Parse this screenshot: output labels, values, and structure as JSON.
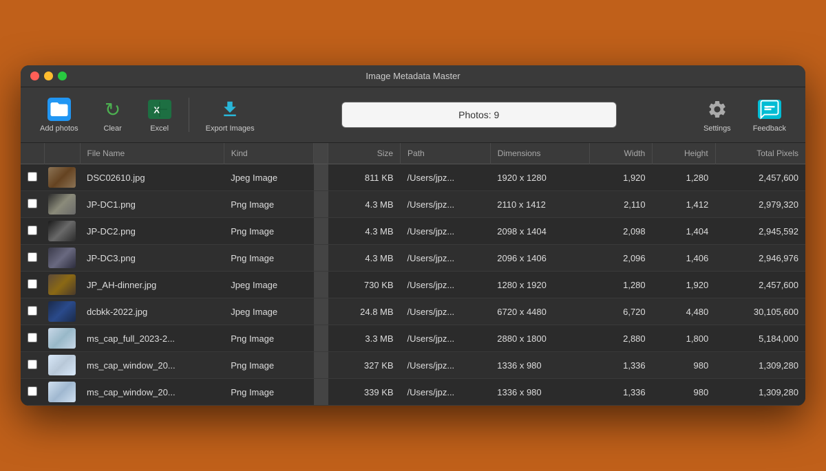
{
  "window": {
    "title": "Image Metadata Master"
  },
  "toolbar": {
    "add_photos_label": "Add photos",
    "clear_label": "Clear",
    "excel_label": "Excel",
    "export_label": "Export Images",
    "settings_label": "Settings",
    "feedback_label": "Feedback",
    "photos_display": "Photos: 9"
  },
  "table": {
    "headers": [
      "",
      "",
      "File Name",
      "Kind",
      "",
      "Size",
      "Path",
      "Dimensions",
      "Width",
      "Height",
      "Total Pixels"
    ],
    "rows": [
      {
        "checked": false,
        "thumb_class": "thumb-1",
        "filename": "DSC02610.jpg",
        "kind": "Jpeg Image",
        "size": "811 KB",
        "path": "/Users/jpz...",
        "dimensions": "1920 x 1280",
        "width": "1,920",
        "height": "1,280",
        "total_pixels": "2,457,600"
      },
      {
        "checked": false,
        "thumb_class": "thumb-2",
        "filename": "JP-DC1.png",
        "kind": "Png Image",
        "size": "4.3 MB",
        "path": "/Users/jpz...",
        "dimensions": "2110 x 1412",
        "width": "2,110",
        "height": "1,412",
        "total_pixels": "2,979,320"
      },
      {
        "checked": false,
        "thumb_class": "thumb-3",
        "filename": "JP-DC2.png",
        "kind": "Png Image",
        "size": "4.3 MB",
        "path": "/Users/jpz...",
        "dimensions": "2098 x 1404",
        "width": "2,098",
        "height": "1,404",
        "total_pixels": "2,945,592"
      },
      {
        "checked": false,
        "thumb_class": "thumb-4",
        "filename": "JP-DC3.png",
        "kind": "Png Image",
        "size": "4.3 MB",
        "path": "/Users/jpz...",
        "dimensions": "2096 x 1406",
        "width": "2,096",
        "height": "1,406",
        "total_pixels": "2,946,976"
      },
      {
        "checked": false,
        "thumb_class": "thumb-5",
        "filename": "JP_AH-dinner.jpg",
        "kind": "Jpeg Image",
        "size": "730 KB",
        "path": "/Users/jpz...",
        "dimensions": "1280 x 1920",
        "width": "1,280",
        "height": "1,920",
        "total_pixels": "2,457,600"
      },
      {
        "checked": false,
        "thumb_class": "thumb-6",
        "filename": "dcbkk-2022.jpg",
        "kind": "Jpeg Image",
        "size": "24.8 MB",
        "path": "/Users/jpz...",
        "dimensions": "6720 x 4480",
        "width": "6,720",
        "height": "4,480",
        "total_pixels": "30,105,600"
      },
      {
        "checked": false,
        "thumb_class": "thumb-7",
        "filename": "ms_cap_full_2023-2...",
        "kind": "Png Image",
        "size": "3.3 MB",
        "path": "/Users/jpz...",
        "dimensions": "2880 x 1800",
        "width": "2,880",
        "height": "1,800",
        "total_pixels": "5,184,000"
      },
      {
        "checked": false,
        "thumb_class": "thumb-8",
        "filename": "ms_cap_window_20...",
        "kind": "Png Image",
        "size": "327 KB",
        "path": "/Users/jpz...",
        "dimensions": "1336 x 980",
        "width": "1,336",
        "height": "980",
        "total_pixels": "1,309,280"
      },
      {
        "checked": false,
        "thumb_class": "thumb-9",
        "filename": "ms_cap_window_20...",
        "kind": "Png Image",
        "size": "339 KB",
        "path": "/Users/jpz...",
        "dimensions": "1336 x 980",
        "width": "1,336",
        "height": "980",
        "total_pixels": "1,309,280"
      }
    ]
  }
}
